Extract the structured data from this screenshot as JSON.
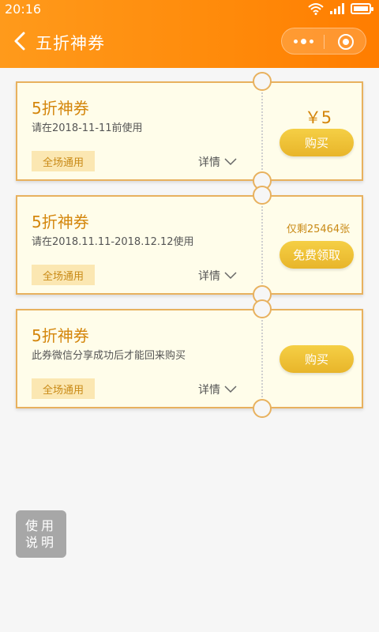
{
  "status_bar": {
    "time": "20:16",
    "icons": [
      "wifi-icon",
      "signal-icon",
      "battery-icon"
    ]
  },
  "nav": {
    "title": "五折神券",
    "back_icon": "chevron-left-icon",
    "more_icon": "more-dots-icon",
    "close_icon": "target-circle-icon"
  },
  "colors": {
    "header_orange": "#ff8a0a",
    "coupon_bg": "#fffdea",
    "coupon_border": "#e8b15e",
    "gold_text": "#d4860c",
    "button_gold": "#efc03a",
    "tag_bg": "#fbe7b2",
    "guide_bg": "#a7a7a7"
  },
  "coupons": [
    {
      "title": "5折神券",
      "subtitle": "请在2018-11-11前使用",
      "tag": "全场通用",
      "detail": "详情",
      "price": "￥5",
      "remaining": "",
      "button": "购买"
    },
    {
      "title": "5折神券",
      "subtitle": "请在2018.11.11-2018.12.12使用",
      "tag": "全场通用",
      "detail": "详情",
      "price": "",
      "remaining": "仅剩25464张",
      "button": "免费领取"
    },
    {
      "title": "5折神券",
      "subtitle": "此券微信分享成功后才能回来购买",
      "tag": "全场通用",
      "detail": "详情",
      "price": "",
      "remaining": "",
      "button": "购买"
    }
  ],
  "guide_button": {
    "line1": "使用",
    "line2": "说明"
  }
}
